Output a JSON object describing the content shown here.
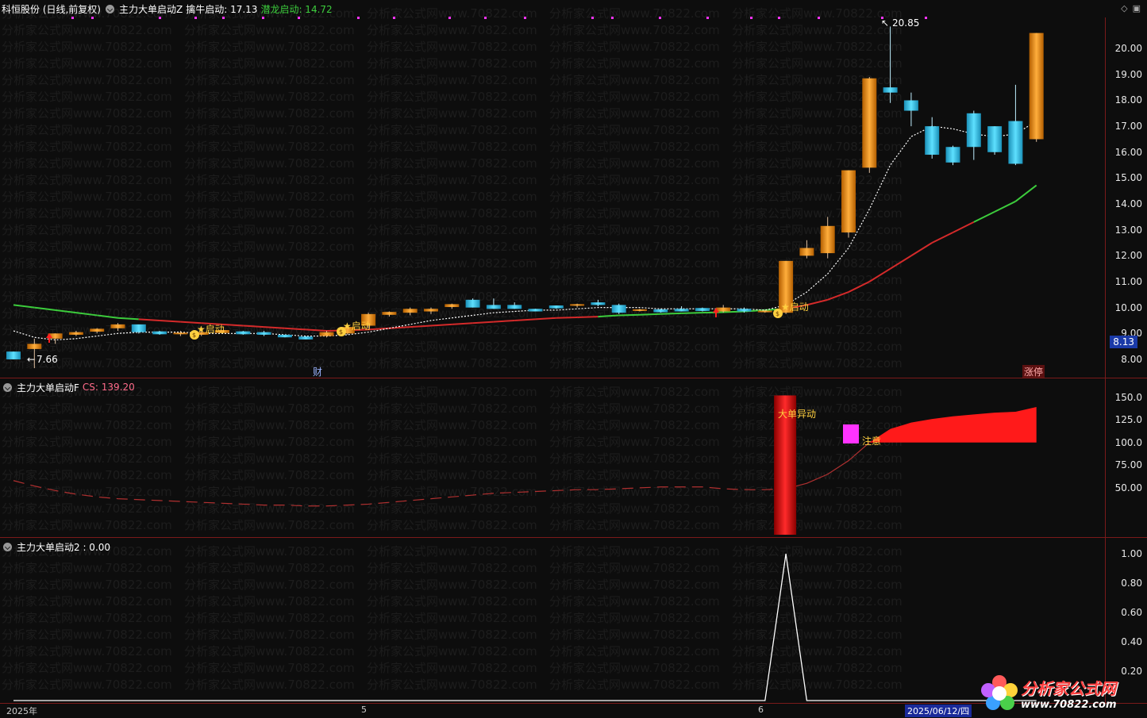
{
  "header": {
    "stock": "科恒股份 (日线,前复权)",
    "indicator": "主力大单启动Z",
    "qinniu_label": "擒牛启动: 17.13",
    "qianlong_label": "潜龙启动: 14.72"
  },
  "panel2": {
    "title": "主力大单启动F",
    "value_label": "CS: 139.20"
  },
  "panel3": {
    "title": "主力大单启动2 : 0.00"
  },
  "price_axis": [
    "20.00",
    "19.00",
    "18.00",
    "17.00",
    "16.00",
    "15.00",
    "14.00",
    "13.00",
    "12.00",
    "11.00",
    "10.00",
    "9.00",
    "8.00"
  ],
  "current_price": "8.13",
  "cs_axis": [
    "150.0",
    "125.0",
    "100.0",
    "75.00",
    "50.00"
  ],
  "sig_axis": [
    "1.00",
    "0.80",
    "0.60",
    "0.40",
    "0.20"
  ],
  "annotations": {
    "high": "20.85",
    "low": "7.66",
    "start": "★启动",
    "cai": "财",
    "zhangting": "涨停",
    "big_order": "大单异动",
    "attention": "注意"
  },
  "xaxis": {
    "year": "2025年",
    "m5": "5",
    "m6": "6",
    "cursor_date": "2025/06/12/四"
  },
  "watermark": "分析家公式网www.70822.com",
  "logo": {
    "main": "分析家公式网",
    "sub": "www.70822.com"
  },
  "colors": {
    "up": "#e8901c",
    "down": "#2ec6ea",
    "ma_red": "#d42a2a",
    "ma_green": "#3ccc3c",
    "signal_red": "#e01818",
    "magenta": "#ff33ff"
  },
  "chart_data": {
    "type": "candlestick",
    "ohlc": [
      [
        8.3,
        8.3,
        8.0,
        8.0
      ],
      [
        8.4,
        8.8,
        7.66,
        8.6
      ],
      [
        8.8,
        9.0,
        8.6,
        9.0
      ],
      [
        8.95,
        9.1,
        8.9,
        9.05
      ],
      [
        9.1,
        9.2,
        9.0,
        9.15
      ],
      [
        9.2,
        9.4,
        9.1,
        9.35
      ],
      [
        9.35,
        9.3,
        9.0,
        9.05
      ],
      [
        9.05,
        9.1,
        8.95,
        9.0
      ],
      [
        9.0,
        9.1,
        8.9,
        9.0
      ],
      [
        8.95,
        9.1,
        8.9,
        9.05
      ],
      [
        9.05,
        9.1,
        9.0,
        9.1
      ],
      [
        9.05,
        9.1,
        8.95,
        9.0
      ],
      [
        9.05,
        9.1,
        8.9,
        8.95
      ],
      [
        8.95,
        8.95,
        8.85,
        8.85
      ],
      [
        8.85,
        8.9,
        8.8,
        8.8
      ],
      [
        8.9,
        9.1,
        8.85,
        9.05
      ],
      [
        9.0,
        9.3,
        8.95,
        9.25
      ],
      [
        9.3,
        9.8,
        9.2,
        9.75
      ],
      [
        9.75,
        9.85,
        9.65,
        9.8
      ],
      [
        9.8,
        10.0,
        9.7,
        9.95
      ],
      [
        9.85,
        10.0,
        9.75,
        9.95
      ],
      [
        10.05,
        10.15,
        9.95,
        10.1
      ],
      [
        10.3,
        10.35,
        10.0,
        10.0
      ],
      [
        10.1,
        10.35,
        9.95,
        9.95
      ],
      [
        10.1,
        10.2,
        9.95,
        9.95
      ],
      [
        9.95,
        9.95,
        9.85,
        9.85
      ],
      [
        10.05,
        10.05,
        9.95,
        10.0
      ],
      [
        10.1,
        10.15,
        10.0,
        10.1
      ],
      [
        10.2,
        10.3,
        10.05,
        10.1
      ],
      [
        10.1,
        10.15,
        9.75,
        9.8
      ],
      [
        9.9,
        9.95,
        9.85,
        9.9
      ],
      [
        9.9,
        9.95,
        9.8,
        9.85
      ],
      [
        9.95,
        10.05,
        9.85,
        9.85
      ],
      [
        9.95,
        10.0,
        9.85,
        9.9
      ],
      [
        9.85,
        10.1,
        9.8,
        10.0
      ],
      [
        9.95,
        10.0,
        9.8,
        9.85
      ],
      [
        9.85,
        9.9,
        9.8,
        9.85
      ],
      [
        9.8,
        11.8,
        9.75,
        11.8
      ],
      [
        12.0,
        12.6,
        11.9,
        12.3
      ],
      [
        12.1,
        13.5,
        11.9,
        13.15
      ],
      [
        12.9,
        15.3,
        12.7,
        15.3
      ],
      [
        15.4,
        18.9,
        15.2,
        18.85
      ],
      [
        18.5,
        20.85,
        17.9,
        18.3
      ],
      [
        18.0,
        18.3,
        17.0,
        17.6
      ],
      [
        17.0,
        17.35,
        15.75,
        15.9
      ],
      [
        16.2,
        16.25,
        15.5,
        15.6
      ],
      [
        17.5,
        17.6,
        15.7,
        16.2
      ],
      [
        17.0,
        17.0,
        15.9,
        16.0
      ],
      [
        17.2,
        18.6,
        15.5,
        15.55
      ],
      [
        16.5,
        20.6,
        16.4,
        20.6
      ]
    ],
    "ma_short": [
      9.1,
      8.85,
      8.75,
      8.8,
      8.9,
      9.0,
      9.05,
      9.05,
      9.05,
      9.0,
      9.0,
      9.0,
      9.0,
      8.95,
      8.9,
      8.9,
      8.95,
      9.05,
      9.2,
      9.35,
      9.5,
      9.6,
      9.7,
      9.8,
      9.85,
      9.9,
      9.9,
      9.95,
      10.0,
      10.0,
      10.0,
      9.95,
      9.95,
      9.95,
      9.95,
      9.95,
      9.9,
      10.1,
      10.6,
      11.3,
      12.3,
      13.8,
      15.5,
      16.6,
      17.0,
      16.9,
      16.7,
      16.6,
      16.7,
      17.2
    ],
    "ma_long": [
      10.1,
      10.0,
      9.9,
      9.8,
      9.7,
      9.6,
      9.55,
      9.5,
      9.45,
      9.4,
      9.35,
      9.3,
      9.25,
      9.2,
      9.15,
      9.1,
      9.12,
      9.15,
      9.2,
      9.25,
      9.3,
      9.35,
      9.4,
      9.45,
      9.5,
      9.55,
      9.6,
      9.62,
      9.65,
      9.7,
      9.72,
      9.75,
      9.78,
      9.8,
      9.82,
      9.85,
      9.9,
      9.95,
      10.1,
      10.3,
      10.6,
      11.0,
      11.5,
      12.0,
      12.5,
      12.9,
      13.3,
      13.7,
      14.1,
      14.72
    ],
    "cs_line": [
      58,
      52,
      47,
      43,
      40,
      38,
      37,
      36,
      35,
      34,
      33,
      32,
      31,
      31,
      30,
      30,
      31,
      32,
      34,
      36,
      38,
      40,
      42,
      44,
      45,
      46,
      47,
      48,
      48,
      49,
      50,
      51,
      51,
      51,
      49,
      48,
      48,
      49,
      55,
      65,
      80,
      100,
      115,
      122,
      126,
      129,
      131,
      133,
      134,
      139.2
    ],
    "signal": {
      "peak_index": 37,
      "peak_value": 1.0
    },
    "ylim_price": [
      7.6,
      21.2
    ],
    "ylim_cs": [
      0,
      155
    ]
  }
}
